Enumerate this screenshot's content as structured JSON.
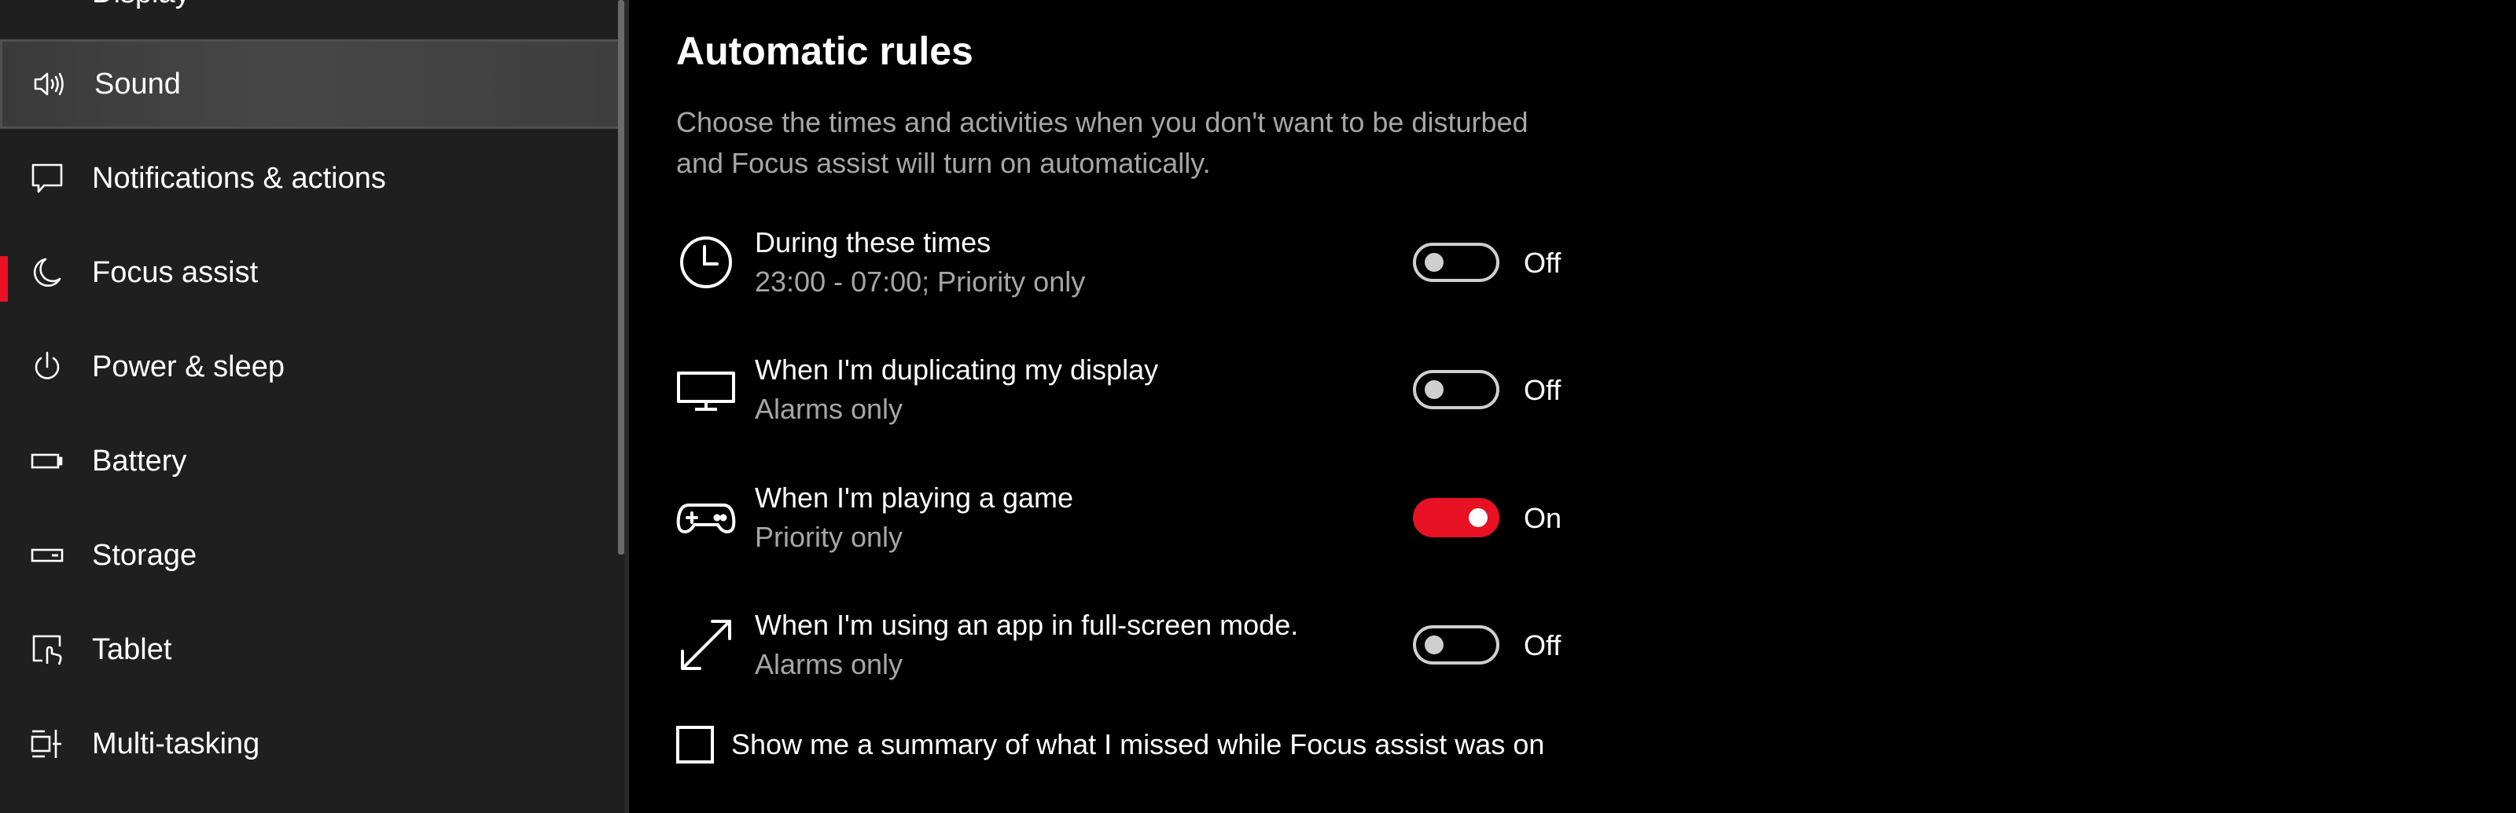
{
  "sidebar": {
    "partial_item": "Display",
    "items": [
      {
        "label": "Sound",
        "icon": "speaker-icon",
        "state": "hover"
      },
      {
        "label": "Notifications & actions",
        "icon": "message-icon"
      },
      {
        "label": "Focus assist",
        "icon": "moon-icon",
        "state": "selected"
      },
      {
        "label": "Power & sleep",
        "icon": "power-icon"
      },
      {
        "label": "Battery",
        "icon": "battery-icon"
      },
      {
        "label": "Storage",
        "icon": "storage-icon"
      },
      {
        "label": "Tablet",
        "icon": "tablet-icon"
      },
      {
        "label": "Multi-tasking",
        "icon": "multitasking-icon"
      }
    ]
  },
  "main": {
    "title": "Automatic rules",
    "description": "Choose the times and activities when you don't want to be disturbed and Focus assist will turn on automatically.",
    "rules": [
      {
        "title": "During these times",
        "subtitle": "23:00 - 07:00; Priority only",
        "icon": "clock-icon",
        "on": false,
        "state_label": "Off"
      },
      {
        "title": "When I'm duplicating my display",
        "subtitle": "Alarms only",
        "icon": "monitor-icon",
        "on": false,
        "state_label": "Off"
      },
      {
        "title": "When I'm playing a game",
        "subtitle": "Priority only",
        "icon": "gamepad-icon",
        "on": true,
        "state_label": "On"
      },
      {
        "title": "When I'm using an app in full-screen mode.",
        "subtitle": "Alarms only",
        "icon": "fullscreen-arrow-icon",
        "on": false,
        "state_label": "Off"
      }
    ],
    "summary_checkbox": {
      "label": "Show me a summary of what I missed while Focus assist was on",
      "checked": false
    }
  },
  "colors": {
    "accent": "#e81123",
    "sidebar_bg": "#1f1f1f",
    "main_bg": "#000000",
    "secondary_text": "#a6a6a6"
  }
}
